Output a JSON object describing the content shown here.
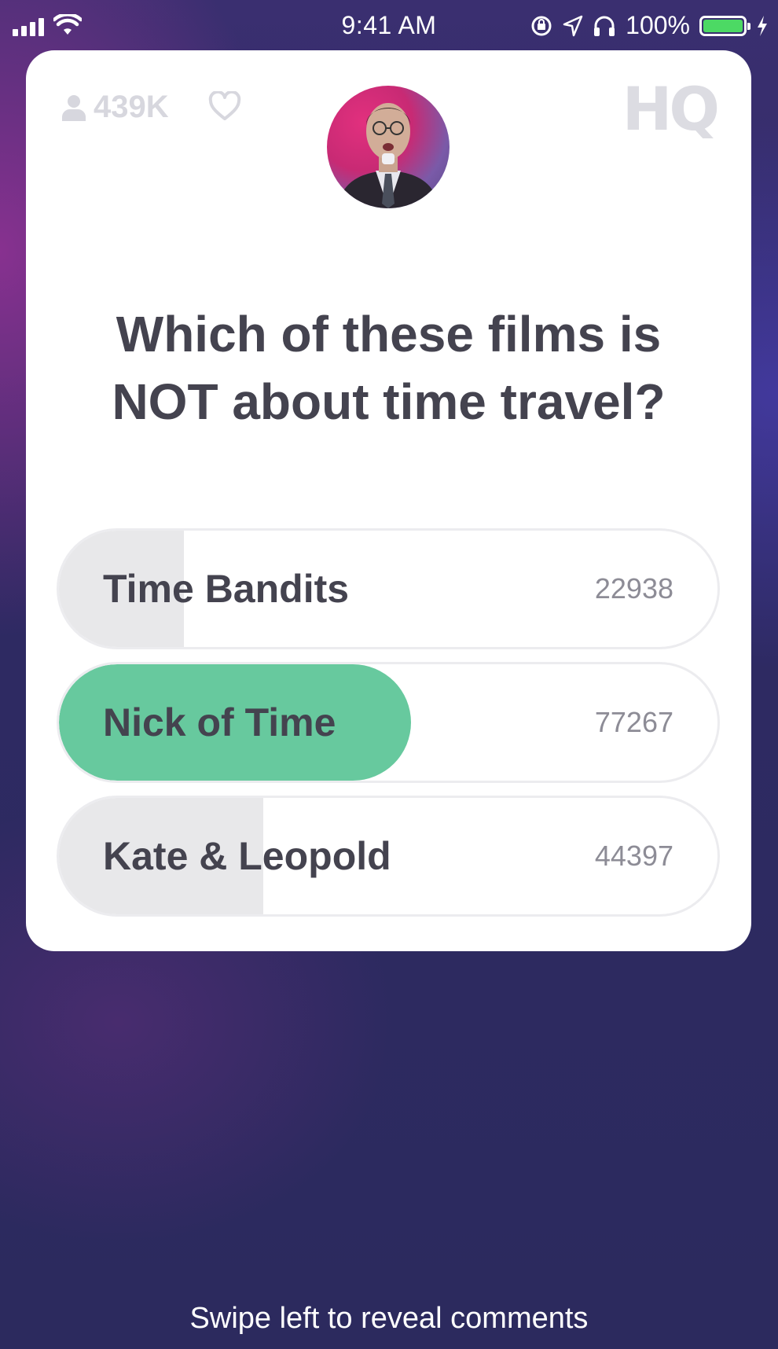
{
  "status_bar": {
    "time": "9:41 AM",
    "battery_text": "100%"
  },
  "header": {
    "viewer_count": "439K",
    "logo_text": "HQ"
  },
  "question": {
    "text": "Which of these films is NOT about time travel?"
  },
  "answers": [
    {
      "label": "Time Bandits",
      "count": "22938",
      "share": 0.19,
      "correct": false
    },
    {
      "label": "Nick of Time",
      "count": "77267",
      "share": 0.535,
      "correct": true
    },
    {
      "label": "Kate & Leopold",
      "count": "44397",
      "share": 0.31,
      "correct": false
    }
  ],
  "footer": {
    "hint": "Swipe left to reveal comments"
  },
  "colors": {
    "correct": "#67c99e",
    "bar": "#e8e8ea",
    "text": "#44434f",
    "background": "#2e2a63"
  }
}
